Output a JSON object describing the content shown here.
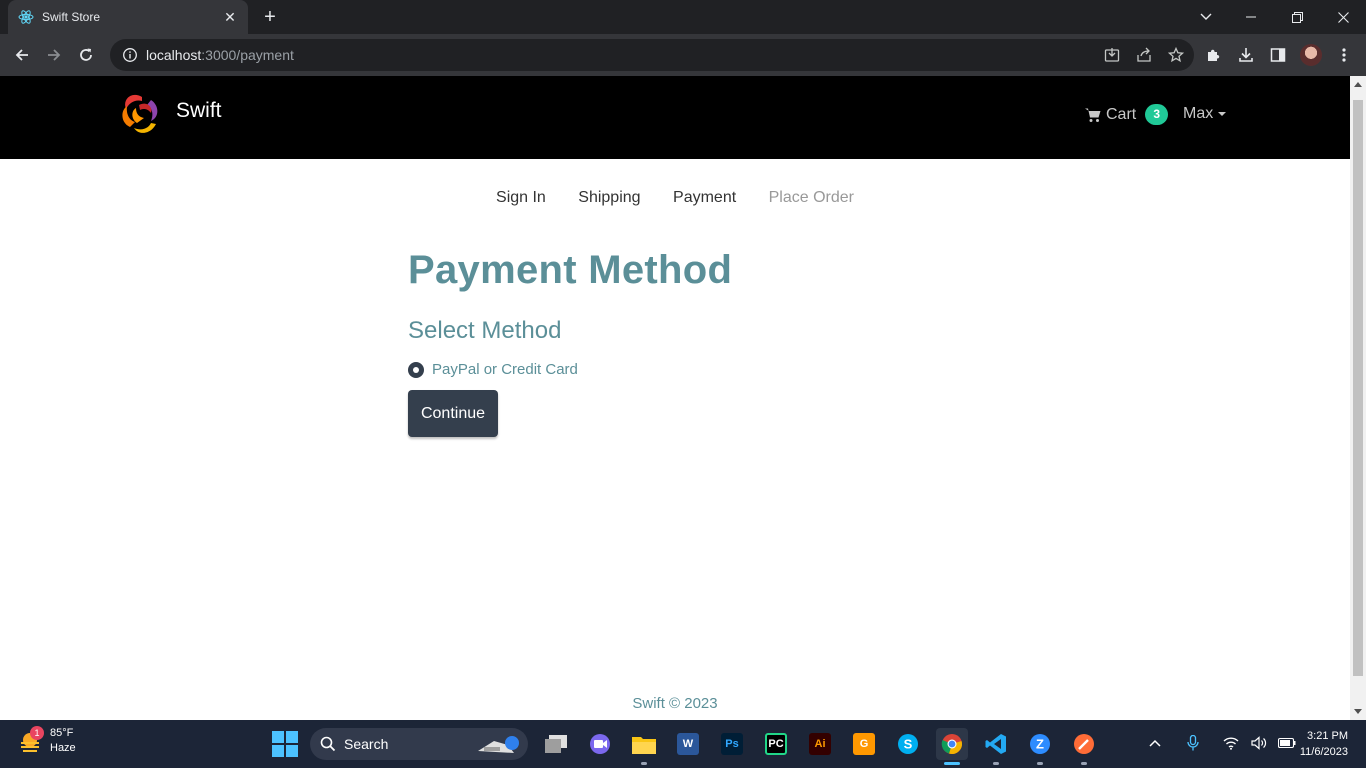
{
  "browser": {
    "tab_title": "Swift Store",
    "url_host": "localhost",
    "url_path": ":3000/payment"
  },
  "navbar": {
    "brand_name": "Swift",
    "cart_label": "Cart",
    "cart_count": "3",
    "user_name": "Max"
  },
  "steps": {
    "sign_in": "Sign In",
    "shipping": "Shipping",
    "payment": "Payment",
    "place_order": "Place Order"
  },
  "form": {
    "title": "Payment Method",
    "legend": "Select Method",
    "option_label": "PayPal or Credit Card",
    "continue_label": "Continue"
  },
  "footer": {
    "text": "Swift © 2023"
  },
  "taskbar": {
    "temperature": "85°F",
    "weather": "Haze",
    "weather_badge": "1",
    "search_label": "Search",
    "time": "3:21 PM",
    "date": "11/6/2023"
  },
  "colors": {
    "accent": "#5b8f98",
    "button": "#343f4d",
    "badge": "#20c997"
  }
}
